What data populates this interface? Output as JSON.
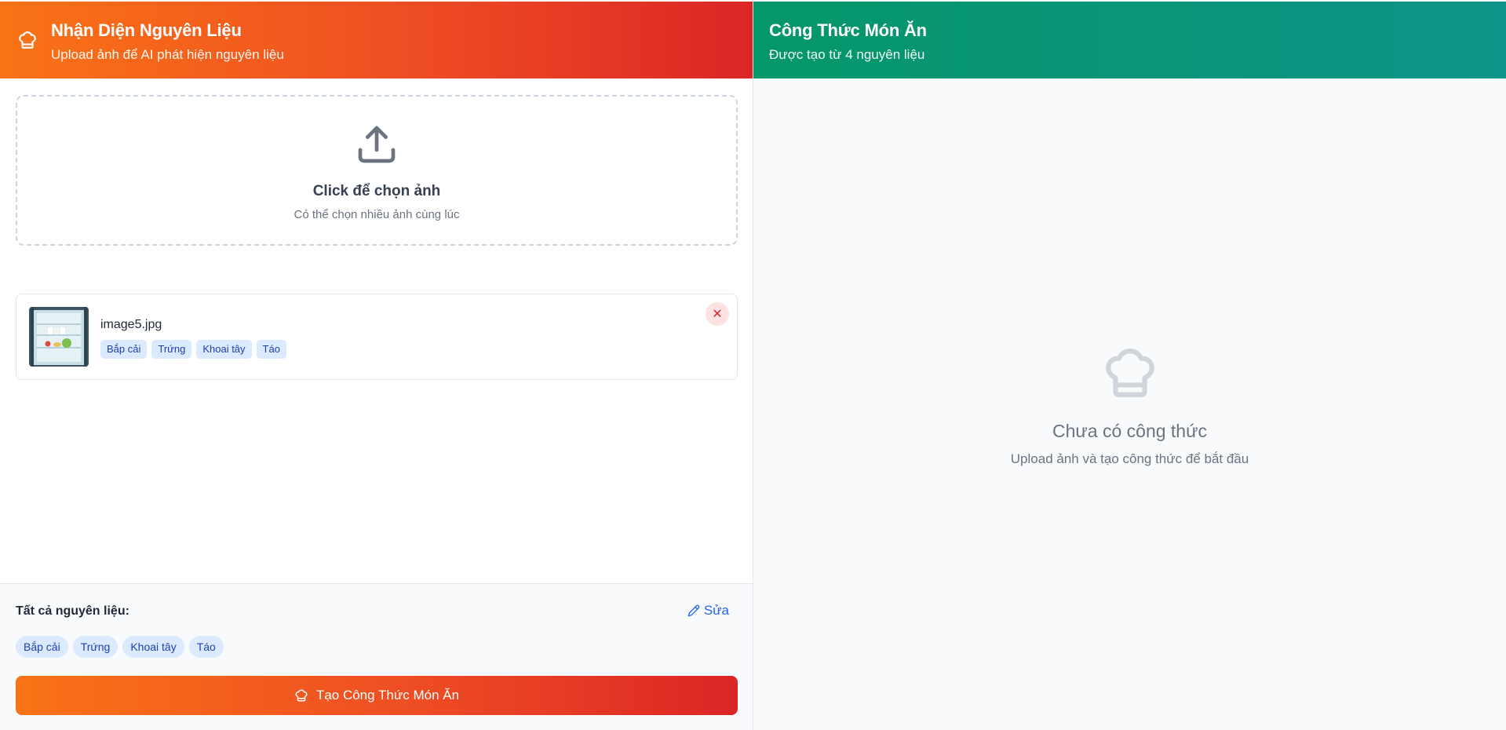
{
  "left_panel": {
    "header": {
      "icon": "chef-hat-icon",
      "title": "Nhận Diện Nguyên Liệu",
      "subtitle": "Upload ảnh để AI phát hiện nguyên liệu"
    },
    "upload": {
      "icon": "upload-icon",
      "title": "Click để chọn ảnh",
      "subtitle": "Có thể chọn nhiều ảnh cùng lúc"
    },
    "images": [
      {
        "file_name": "image5.jpg",
        "ingredients": [
          "Bắp cải",
          "Trứng",
          "Khoai tây",
          "Táo"
        ],
        "remove_label": "✕"
      }
    ],
    "all_ingredients": {
      "label": "Tất cả nguyên liệu:",
      "edit_label": "Sửa",
      "items": [
        "Bắp cải",
        "Trứng",
        "Khoai tây",
        "Táo"
      ]
    },
    "generate_button": {
      "icon": "chef-hat-icon",
      "label": "Tạo Công Thức Món Ăn"
    }
  },
  "right_panel": {
    "header": {
      "title": "Công Thức Món Ăn",
      "subtitle": "Được tạo từ 4 nguyên liệu"
    },
    "empty_state": {
      "icon": "chef-hat-icon",
      "title": "Chưa có công thức",
      "subtitle": "Upload ảnh và tạo công thức để bắt đầu"
    }
  },
  "colors": {
    "left_accent_start": "#f97316",
    "left_accent_end": "#dc2626",
    "right_accent_start": "#059669",
    "right_accent_end": "#0d9488",
    "chip_bg": "#dbeafe",
    "chip_text": "#1e40af",
    "link": "#2563eb"
  }
}
